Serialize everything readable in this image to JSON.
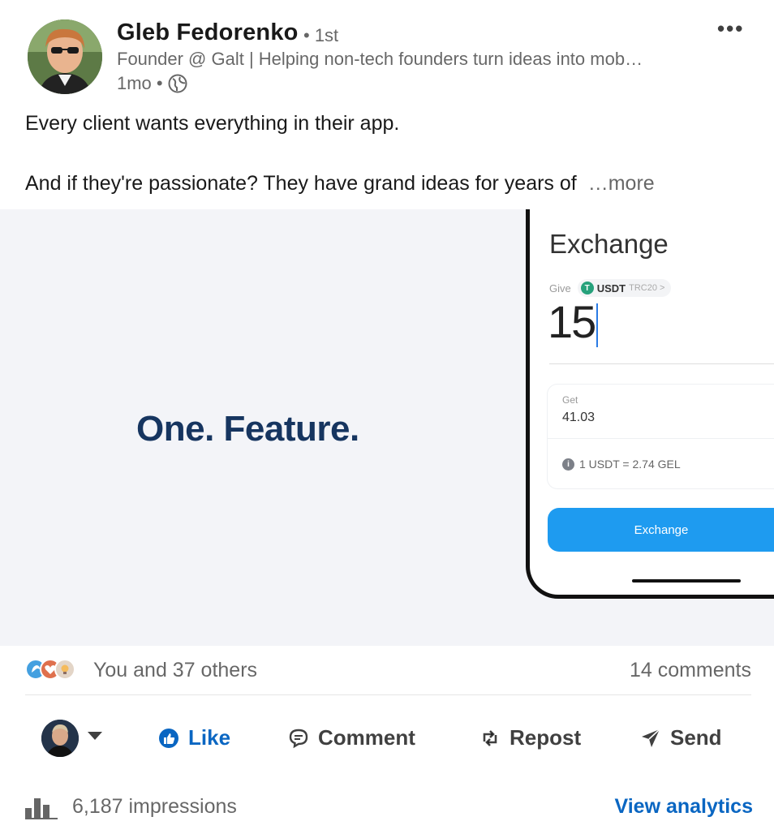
{
  "author": {
    "name": "Gleb Fedorenko",
    "degree": "• 1st",
    "headline": "Founder @ Galt | Helping non-tech founders turn ideas into mob…",
    "time": "1mo •"
  },
  "post": {
    "line1": "Every client wants everything in their app.",
    "line2": "And if they're passionate? They have grand ideas for years of",
    "see_more": "…more"
  },
  "media": {
    "slogan": "One. Feature.",
    "screen_title": "Exchange",
    "give_label": "Give",
    "currency": "USDT",
    "network": "TRC20 >",
    "amount": "15",
    "get_label": "Get",
    "get_value": "41.03",
    "rate": "1 USDT = 2.74 GEL",
    "button_label": "Exchange"
  },
  "social": {
    "reactors": "You and 37 others",
    "comments": "14 comments"
  },
  "actions": {
    "like": "Like",
    "comment": "Comment",
    "repost": "Repost",
    "send": "Send"
  },
  "analytics": {
    "impressions": "6,187 impressions",
    "view_analytics": "View analytics"
  },
  "colors": {
    "accent": "#0a66c2",
    "slogan": "#163560",
    "app_button": "#1e9bf0"
  }
}
